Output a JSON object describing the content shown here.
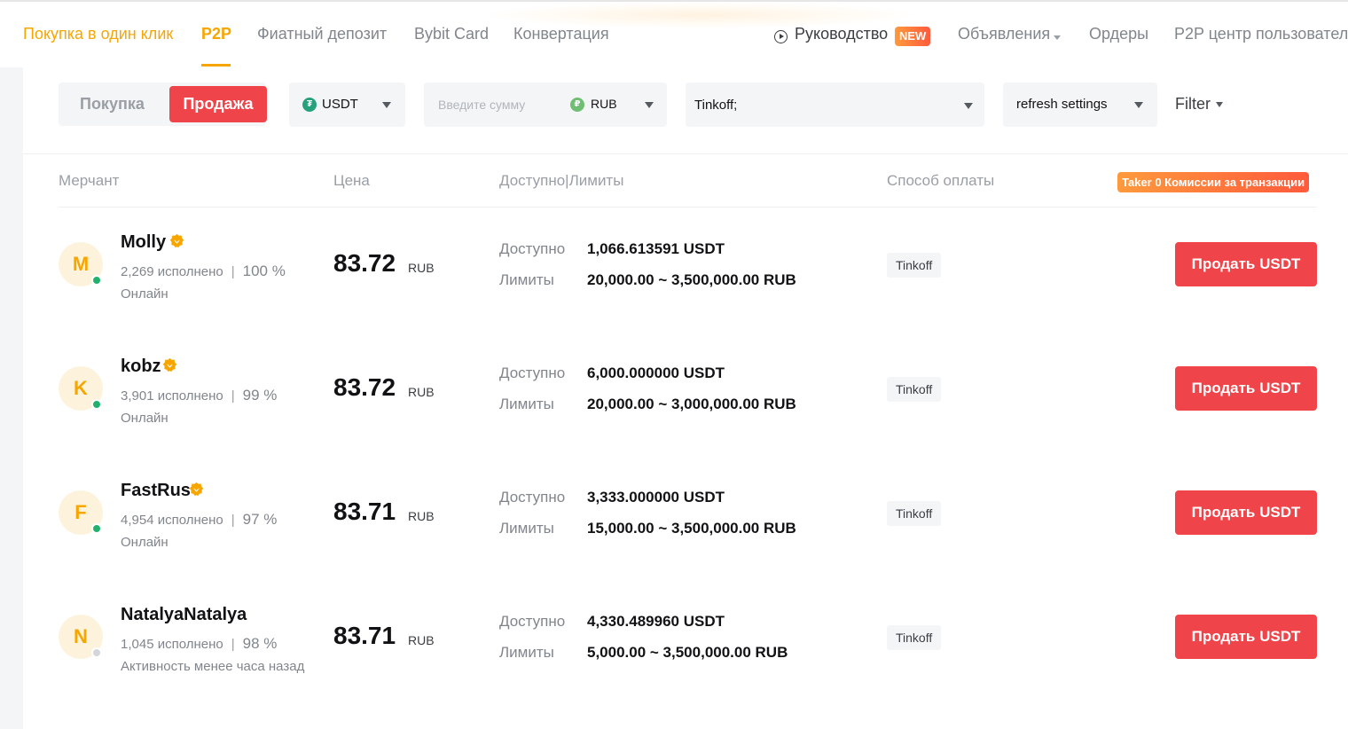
{
  "nav": {
    "items": [
      "Покупка в один клик",
      "P2P",
      "Фиатный депозит",
      "Bybit Card",
      "Конвертация"
    ],
    "guide": "Руководство",
    "new_badge": "NEW",
    "ads": "Объявления",
    "orders": "Ордеры",
    "user_center": "P2P центр пользователя"
  },
  "filters": {
    "buy_label": "Покупка",
    "sell_label": "Продажа",
    "coin": "USDT",
    "amount_placeholder": "Введите сумму",
    "fiat": "RUB",
    "payment": "Tinkoff;",
    "refresh": "refresh settings",
    "filter_label": "Filter",
    "accent_color": "#ef454a",
    "brand_color": "#f7a600"
  },
  "table": {
    "headers": {
      "merchant": "Мерчант",
      "price": "Цена",
      "available_limits": "Доступно|Лимиты",
      "payment_method": "Способ оплаты"
    },
    "taker_badge": "Taker 0 Комиссии за транзакции",
    "available_label": "Доступно",
    "limits_label": "Лимиты",
    "currency": "RUB",
    "sell_button": "Продать USDT",
    "rows": [
      {
        "initial": "M",
        "name": "Molly",
        "verified": true,
        "orders": "2,269 исполнено",
        "completion": "100 %",
        "status": "Онлайн",
        "online": true,
        "price": "83.72",
        "available": "1,066.613591 USDT",
        "limits": "20,000.00 ~ 3,500,000.00 RUB",
        "payment": "Tinkoff"
      },
      {
        "initial": "K",
        "name": "kobz",
        "verified": true,
        "orders": "3,901 исполнено",
        "completion": "99 %",
        "status": "Онлайн",
        "online": true,
        "price": "83.72",
        "available": "6,000.000000 USDT",
        "limits": "20,000.00 ~ 3,000,000.00 RUB",
        "payment": "Tinkoff"
      },
      {
        "initial": "F",
        "name": "FastRus",
        "verified": true,
        "orders": "4,954 исполнено",
        "completion": "97 %",
        "status": "Онлайн",
        "online": true,
        "price": "83.71",
        "available": "3,333.000000 USDT",
        "limits": "15,000.00 ~ 3,500,000.00 RUB",
        "payment": "Tinkoff"
      },
      {
        "initial": "N",
        "name": "NatalyaNatalya",
        "verified": false,
        "orders": "1,045 исполнено",
        "completion": "98 %",
        "status": "Активность менее часа назад",
        "online": false,
        "price": "83.71",
        "available": "4,330.489960 USDT",
        "limits": "5,000.00 ~ 3,500,000.00 RUB",
        "payment": "Tinkoff"
      }
    ]
  }
}
